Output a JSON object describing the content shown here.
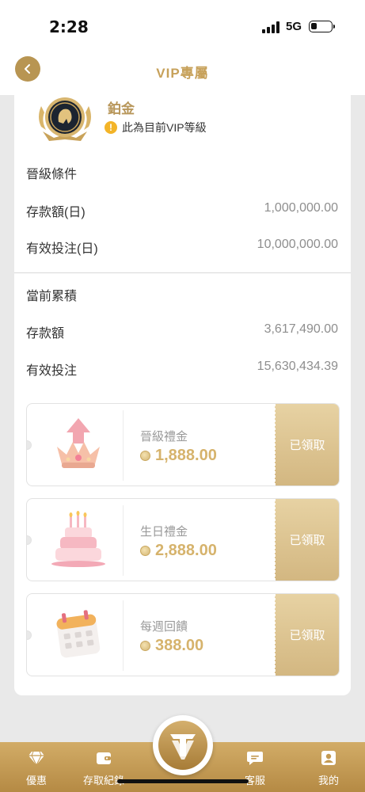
{
  "status_bar": {
    "time": "2:28",
    "network": "5G"
  },
  "nav": {
    "title": "VIP專屬",
    "back_icon": "chevron-left-icon"
  },
  "tier": {
    "name": "鉑金",
    "notice": "此為目前VIP等級",
    "notice_icon": "warning-icon",
    "badge_icon": "lion-medal-icon"
  },
  "upgrade": {
    "title": "晉級條件",
    "rows": [
      {
        "label": "存款額(日)",
        "value": "1,000,000.00"
      },
      {
        "label": "有效投注(日)",
        "value": "10,000,000.00"
      }
    ]
  },
  "accumulated": {
    "title": "當前累積",
    "rows": [
      {
        "label": "存款額",
        "value": "3,617,490.00"
      },
      {
        "label": "有效投注",
        "value": "15,630,434.39"
      }
    ]
  },
  "rewards": [
    {
      "name": "晉級禮金",
      "amount": "1,888.00",
      "button": "已領取",
      "icon": "crown-upgrade-icon"
    },
    {
      "name": "生日禮金",
      "amount": "2,888.00",
      "button": "已領取",
      "icon": "birthday-cake-icon"
    },
    {
      "name": "每週回饋",
      "amount": "388.00",
      "button": "已領取",
      "icon": "calendar-icon"
    }
  ],
  "tab_bar": {
    "items": [
      {
        "label": "優惠",
        "icon": "diamond-icon"
      },
      {
        "label": "存取紀錄",
        "icon": "wallet-icon"
      },
      {
        "label": "客服",
        "icon": "chat-icon"
      },
      {
        "label": "我的",
        "icon": "user-icon"
      }
    ],
    "center_icon": "brand-logo-icon"
  },
  "colors": {
    "accent": "#c7a15a",
    "tab_bar": "#c49a52",
    "claimed_button": "#dcc28f",
    "amount": "#d6b36c"
  }
}
